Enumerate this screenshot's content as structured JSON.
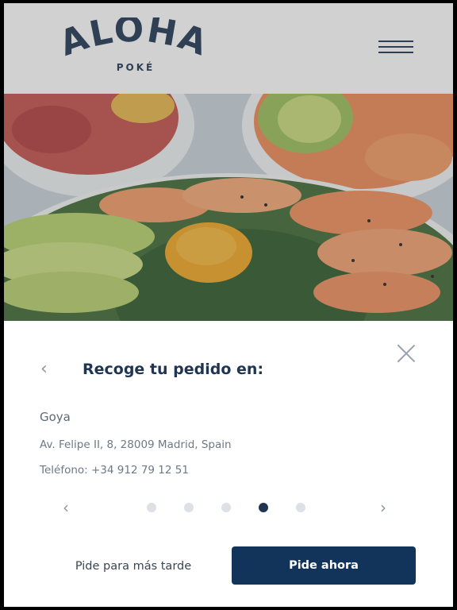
{
  "header": {
    "logo_text": "ALOHA",
    "logo_subtext": "POKÉ",
    "menu_icon": "hamburger-menu-icon"
  },
  "hero": {
    "image": "poke-bowls-photo"
  },
  "pickup_sheet": {
    "title": "Recoge tu pedido en:",
    "back_icon": "chevron-left-icon",
    "close_icon": "close-icon",
    "store": {
      "name": "Goya",
      "address": "Av. Felipe II, 8, 28009 Madrid, Spain",
      "phone": "Teléfono: +34 912 79 12 51"
    },
    "carousel": {
      "prev_icon": "chevron-left-icon",
      "next_icon": "chevron-right-icon",
      "dot_count": 5,
      "active_index": 3
    },
    "buttons": {
      "later": "Pide para más tarde",
      "now": "Pide ahora"
    }
  },
  "colors": {
    "brand_navy": "#12345a",
    "text_navy": "#1f3552",
    "muted": "#6d7986"
  }
}
